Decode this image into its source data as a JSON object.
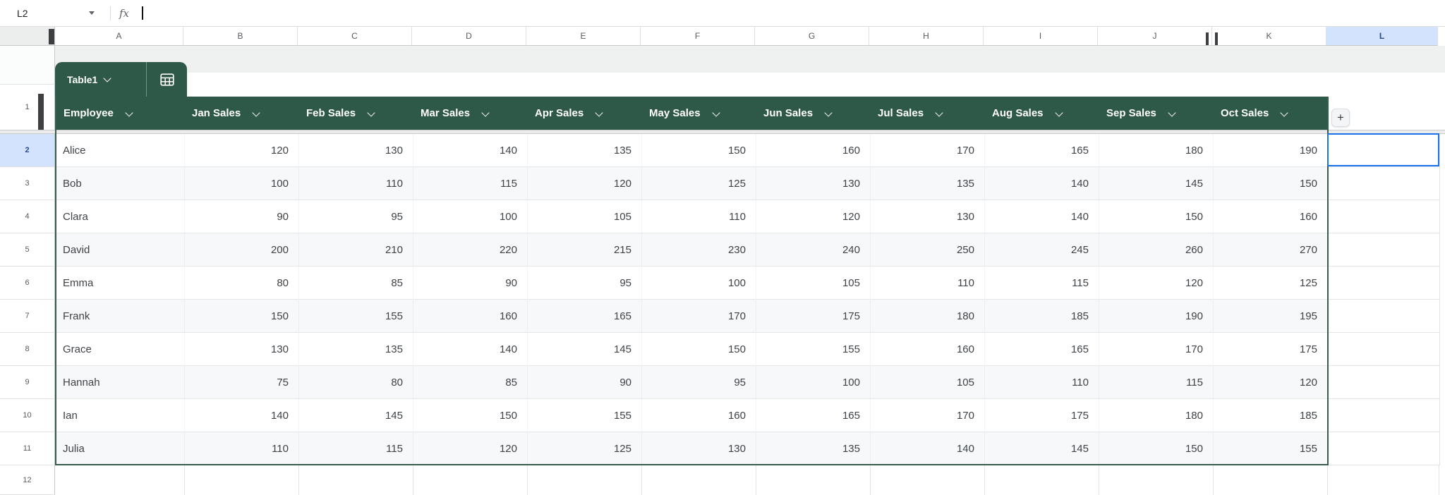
{
  "formula_bar": {
    "cell_ref": "L2",
    "fx_label": "fx",
    "formula_value": ""
  },
  "table": {
    "name": "Table1",
    "columns": [
      "Employee",
      "Jan Sales",
      "Feb Sales",
      "Mar Sales",
      "Apr Sales",
      "May Sales",
      "Jun Sales",
      "Jul Sales",
      "Aug Sales",
      "Sep Sales",
      "Oct Sales"
    ],
    "rows": [
      {
        "name": "Alice",
        "values": [
          120,
          130,
          140,
          135,
          150,
          160,
          170,
          165,
          180,
          190
        ]
      },
      {
        "name": "Bob",
        "values": [
          100,
          110,
          115,
          120,
          125,
          130,
          135,
          140,
          145,
          150
        ]
      },
      {
        "name": "Clara",
        "values": [
          90,
          95,
          100,
          105,
          110,
          120,
          130,
          140,
          150,
          160
        ]
      },
      {
        "name": "David",
        "values": [
          200,
          210,
          220,
          215,
          230,
          240,
          250,
          245,
          260,
          270
        ]
      },
      {
        "name": "Emma",
        "values": [
          80,
          85,
          90,
          95,
          100,
          105,
          110,
          115,
          120,
          125
        ]
      },
      {
        "name": "Frank",
        "values": [
          150,
          155,
          160,
          165,
          170,
          175,
          180,
          185,
          190,
          195
        ]
      },
      {
        "name": "Grace",
        "values": [
          130,
          135,
          140,
          145,
          150,
          155,
          160,
          165,
          170,
          175
        ]
      },
      {
        "name": "Hannah",
        "values": [
          75,
          80,
          85,
          90,
          95,
          100,
          105,
          110,
          115,
          120
        ]
      },
      {
        "name": "Ian",
        "values": [
          140,
          145,
          150,
          155,
          160,
          165,
          170,
          175,
          180,
          185
        ]
      },
      {
        "name": "Julia",
        "values": [
          110,
          115,
          120,
          125,
          130,
          135,
          140,
          145,
          150,
          155
        ]
      }
    ]
  },
  "grid": {
    "column_letters": [
      "A",
      "B",
      "C",
      "D",
      "E",
      "F",
      "G",
      "H",
      "I",
      "J",
      "K",
      "L"
    ],
    "row_numbers": [
      1,
      2,
      3,
      4,
      5,
      6,
      7,
      8,
      9,
      10,
      11,
      12
    ],
    "selected_column": "L",
    "selected_row": 2
  },
  "controls": {
    "add_column_label": "+"
  },
  "colors": {
    "table_green": "#2e5847",
    "table_border_green": "#3a5c4d",
    "banded_row": "#f6f8f9",
    "selection_blue": "#1a73e8",
    "selected_header_bg": "#d3e3fd",
    "selected_header_text": "#2b4a8c",
    "gridline": "#e2e4e5",
    "header_text": "#ffffff",
    "cell_text": "#3f4347",
    "muted_text": "#565a5e"
  }
}
